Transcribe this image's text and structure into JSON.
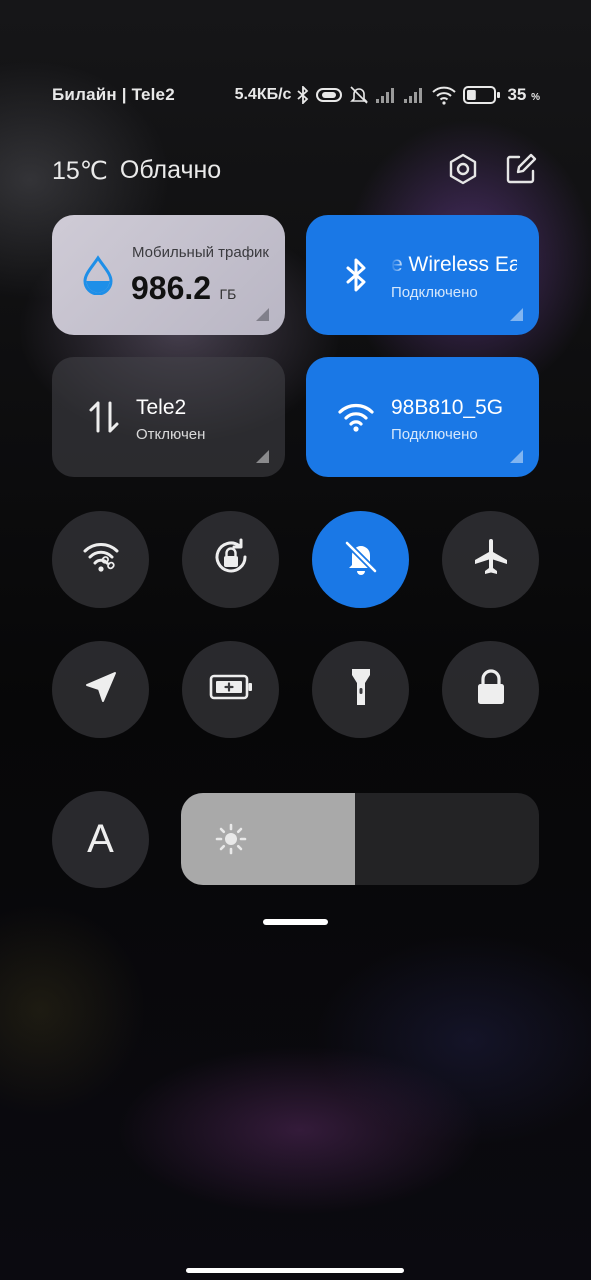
{
  "status_bar": {
    "carrier": "Билайн | Tele2",
    "net_speed": "5.4КБ/с",
    "battery_percent": "35",
    "battery_unit": "%",
    "battery_level": 0.35,
    "icons": [
      "bluetooth-icon",
      "vibrate-icon",
      "silent-icon",
      "signal-icon",
      "signal-icon",
      "wifi-icon",
      "battery-icon"
    ]
  },
  "header": {
    "temperature": "15℃",
    "weather": "Облачно",
    "icons": [
      "settings-icon",
      "edit-icon"
    ]
  },
  "tiles": {
    "mobile_data": {
      "label": "Мобильный трафик",
      "value": "986.2",
      "unit": "ГБ",
      "icon": "water-drop-icon"
    },
    "bluetooth": {
      "title": "Wireless Ea",
      "status": "Подключено",
      "icon": "bluetooth-icon",
      "active": true
    },
    "cellular": {
      "title": "Tele2",
      "status": "Отключен",
      "icon": "data-arrows-icon",
      "active": false
    },
    "wifi": {
      "title": "98B810_5G",
      "status": "Подключено",
      "icon": "wifi-icon",
      "active": true
    }
  },
  "toggles": [
    {
      "name": "wifi-share",
      "icon": "wifi-share-icon",
      "active": false
    },
    {
      "name": "auto-rotate",
      "icon": "rotate-lock-icon",
      "active": false
    },
    {
      "name": "silent",
      "icon": "bell-off-icon",
      "active": true
    },
    {
      "name": "airplane-mode",
      "icon": "airplane-icon",
      "active": false
    },
    {
      "name": "location",
      "icon": "location-arrow-icon",
      "active": false
    },
    {
      "name": "battery-saver",
      "icon": "battery-plus-icon",
      "active": false
    },
    {
      "name": "flashlight",
      "icon": "flashlight-icon",
      "active": false
    },
    {
      "name": "lock-screen",
      "icon": "lock-icon",
      "active": false
    },
    {
      "name": "auto-brightness",
      "icon": "font-a-icon",
      "label": "A",
      "active": false
    }
  ],
  "brightness": {
    "level": 0.485,
    "icon": "sun-icon"
  },
  "colors": {
    "accent": "#1a78e6",
    "tile_dark": "#46464a",
    "tile_light": "#c7c4cf"
  }
}
